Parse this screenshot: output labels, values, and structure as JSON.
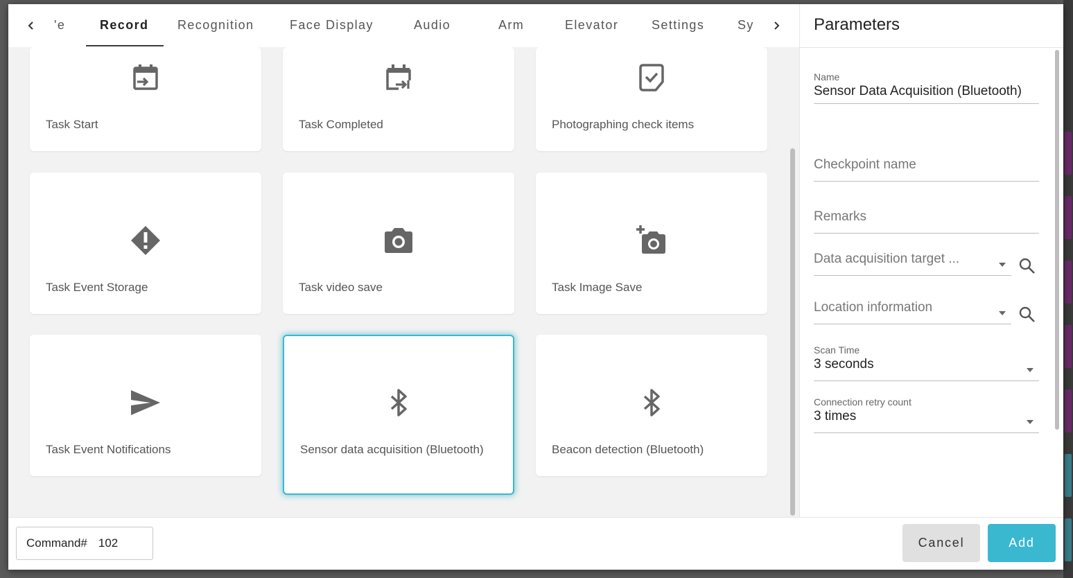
{
  "tabs": {
    "items": [
      {
        "label": "'e"
      },
      {
        "label": "Record"
      },
      {
        "label": "Recognition"
      },
      {
        "label": "Face Display"
      },
      {
        "label": "Audio"
      },
      {
        "label": "Arm"
      },
      {
        "label": "Elevator"
      },
      {
        "label": "Settings"
      },
      {
        "label": "Sy"
      }
    ],
    "active": "Record"
  },
  "cards": [
    {
      "label": "Task Start",
      "icon": "calendar-start-icon"
    },
    {
      "label": "Task Completed",
      "icon": "calendar-end-icon"
    },
    {
      "label": "Photographing check items",
      "icon": "check-note-icon"
    },
    {
      "label": "Task Event Storage",
      "icon": "diamond-alert-icon"
    },
    {
      "label": "Task video save",
      "icon": "camera-icon"
    },
    {
      "label": "Task Image Save",
      "icon": "camera-plus-icon"
    },
    {
      "label": "Task Event Notifications",
      "icon": "send-icon"
    },
    {
      "label": "Sensor data acquisition (Bluetooth)",
      "icon": "bluetooth-icon",
      "selected": true
    },
    {
      "label": "Beacon detection (Bluetooth)",
      "icon": "bluetooth-icon"
    }
  ],
  "params": {
    "title": "Parameters",
    "name_label": "Name",
    "name_value": "Sensor Data Acquisition (Bluetooth)",
    "checkpoint_placeholder": "Checkpoint name",
    "remarks_placeholder": "Remarks",
    "target_placeholder": "Data acquisition target ...",
    "location_placeholder": "Location information",
    "scan_label": "Scan Time",
    "scan_value": "3 seconds",
    "retry_label": "Connection retry count",
    "retry_value": "3 times"
  },
  "footer": {
    "command_label": "Command#",
    "command_value": "102",
    "cancel_label": "Cancel",
    "add_label": "Add"
  },
  "colors": {
    "accent": "#3ab8d0",
    "background_strip": [
      "#6b2a6b",
      "#6b2a6b",
      "#6b2a6b",
      "#6b2a6b",
      "#6b2a6b",
      "#3a7d8a",
      "#3a7d8a"
    ]
  }
}
